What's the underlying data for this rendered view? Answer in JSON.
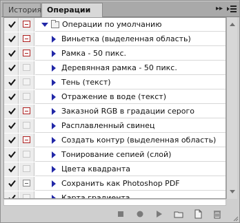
{
  "window": {
    "tabs": [
      {
        "label": "История",
        "active": false
      },
      {
        "label": "Операции",
        "active": true
      }
    ],
    "header_controls": {
      "collapse": "▸▸",
      "menu_icon": "panel-menu-icon"
    }
  },
  "actions_list": {
    "set": {
      "label": "Операции по умолчанию",
      "expanded": true,
      "checked": true,
      "dialog": "red"
    },
    "items": [
      {
        "label": "Виньетка (выделенная область)",
        "checked": true,
        "dialog": "red"
      },
      {
        "label": "Рамка - 50 пикс.",
        "checked": true,
        "dialog": "red"
      },
      {
        "label": "Деревянная рамка - 50 пикс.",
        "checked": true,
        "dialog": "none"
      },
      {
        "label": "Тень (текст)",
        "checked": true,
        "dialog": "none"
      },
      {
        "label": "Отражение в воде (текст)",
        "checked": true,
        "dialog": "none"
      },
      {
        "label": "Заказной RGB в градации серого",
        "checked": true,
        "dialog": "red"
      },
      {
        "label": "Расплавленный свинец",
        "checked": true,
        "dialog": "none"
      },
      {
        "label": "Создать контур (выделенная область)",
        "checked": true,
        "dialog": "red"
      },
      {
        "label": "Тонирование сепией (слой)",
        "checked": true,
        "dialog": "none"
      },
      {
        "label": "Цвета квадранта",
        "checked": true,
        "dialog": "none"
      },
      {
        "label": "Сохранить как Photoshop PDF",
        "checked": true,
        "dialog": "gray"
      },
      {
        "label": "Карта градиента",
        "checked": true,
        "dialog": "none"
      }
    ]
  },
  "bottom_toolbar": {
    "buttons": [
      "stop-icon",
      "record-icon",
      "play-icon",
      "new-set-icon",
      "new-action-icon",
      "delete-icon"
    ]
  },
  "colors": {
    "accent_blue": "#2228a8",
    "dialog_red": "#b02020",
    "panel_gray": "#cfcfcf"
  }
}
